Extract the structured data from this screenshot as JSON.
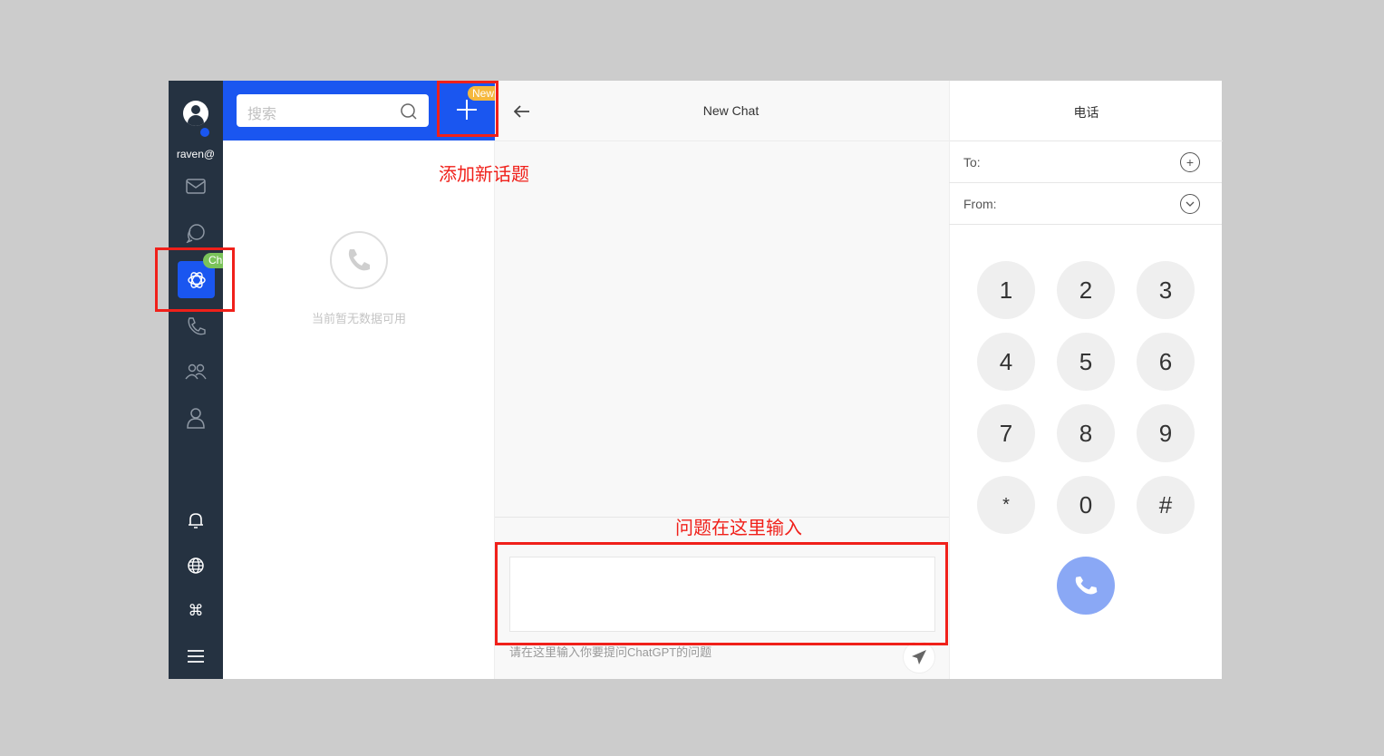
{
  "sidebar": {
    "username": "raven@",
    "chatgpt_badge": "ChatGPT",
    "items": [
      "mail-icon",
      "chat-icon",
      "chatgpt-icon",
      "phone-icon",
      "contacts-icon",
      "user-icon",
      "bell-icon",
      "globe-icon",
      "command-icon",
      "menu-icon"
    ]
  },
  "list": {
    "search_placeholder": "搜索",
    "new_badge": "New",
    "empty_text": "当前暂无数据可用"
  },
  "chat": {
    "title": "New Chat",
    "input_placeholder": "请在这里输入你要提问ChatGPT的问题"
  },
  "dialer": {
    "title": "电话",
    "to_label": "To:",
    "from_label": "From:",
    "keys": [
      "1",
      "2",
      "3",
      "4",
      "5",
      "6",
      "7",
      "8",
      "9",
      "*",
      "0",
      "#"
    ]
  },
  "annotations": {
    "add_topic": "添加新话题",
    "input_here": "问题在这里输入"
  },
  "colors": {
    "brand": "#1a56f0",
    "sidebar": "#253241",
    "call": "#8aa8f5",
    "annotation": "#f0201a",
    "badge_new": "#f5b83d",
    "badge_chatgpt": "#7ac35a"
  }
}
